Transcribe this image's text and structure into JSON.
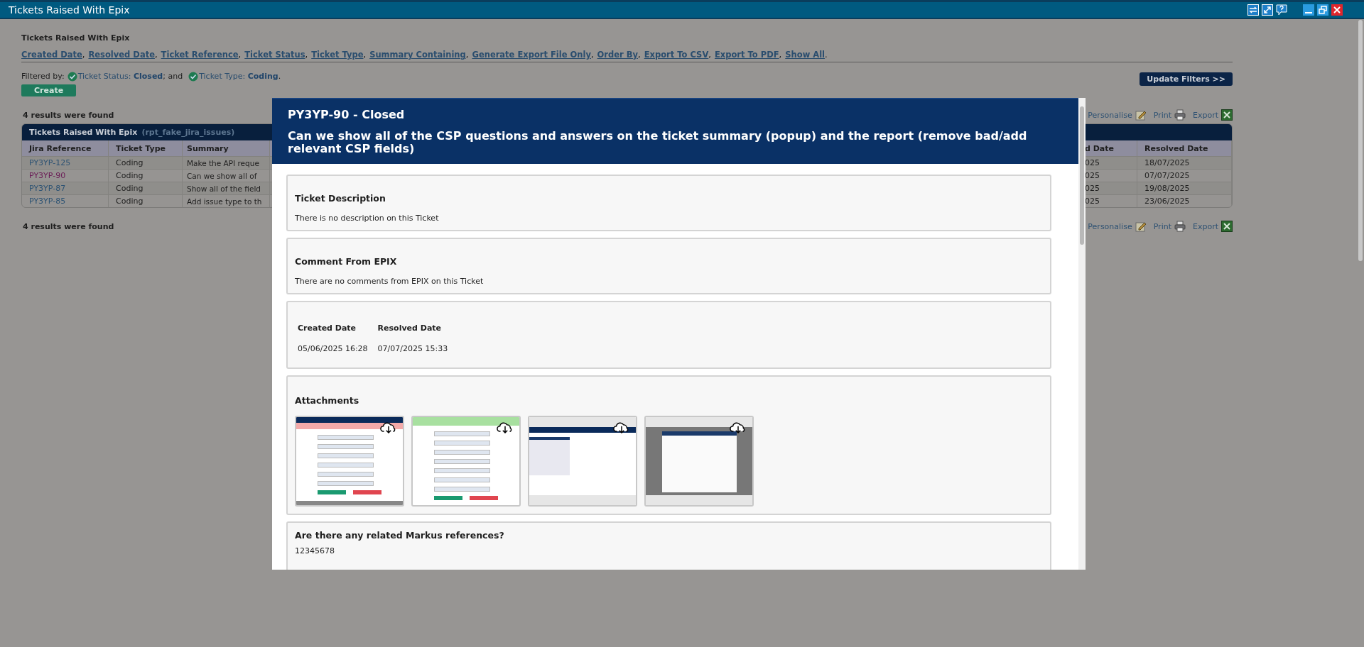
{
  "window": {
    "title": "Tickets Raised With Epix"
  },
  "page": {
    "heading": "Tickets Raised With Epix",
    "filter_links": [
      "Created Date",
      "Resolved Date",
      "Ticket Reference",
      "Ticket Status",
      "Ticket Type",
      "Summary Containing",
      "Generate Export File Only",
      "Order By",
      "Export To CSV",
      "Export To PDF",
      "Show All"
    ],
    "link_separator": ",",
    "links_end": ".",
    "filtered_by": {
      "label": "Filtered by:",
      "filters": [
        {
          "label": "Ticket Status:",
          "value": "Closed",
          "after": "; and"
        },
        {
          "label": "Ticket Type:",
          "value": "Coding",
          "after": "."
        }
      ]
    },
    "update_button": "Update Filters >>",
    "create_button": "Create",
    "results_top": "4 results were found",
    "results_bottom": "4 results were found",
    "toolbar_top": [
      "Personalise",
      "Print",
      "Export"
    ],
    "toolbar_bottom": [
      "Personalise",
      "Print",
      "Export"
    ]
  },
  "table": {
    "title": "Tickets Raised With Epix",
    "subtitle": "(rpt_fake_jira_issues)",
    "columns": [
      "Jira Reference",
      "Ticket Type",
      "Summary",
      "d Date",
      "Resolved Date"
    ],
    "rows": [
      {
        "visited": false,
        "cells": [
          "PY3YP-125",
          "Coding",
          "Make the API reque",
          "025",
          "18/07/2025"
        ]
      },
      {
        "visited": true,
        "cells": [
          "PY3YP-90",
          "Coding",
          "Can we show all of",
          "025",
          "07/07/2025"
        ]
      },
      {
        "visited": false,
        "cells": [
          "PY3YP-87",
          "Coding",
          "Show all of the field",
          "025",
          "19/08/2025"
        ]
      },
      {
        "visited": false,
        "cells": [
          "PY3YP-85",
          "Coding",
          "Add issue type to th",
          "025",
          "23/06/2025"
        ]
      }
    ]
  },
  "modal": {
    "ref_status": "PY3YP-90 - Closed",
    "title": "Can we show all of the CSP questions and answers on the ticket summary (popup) and the report (remove bad/add relevant CSP fields)",
    "sections": [
      {
        "kind": "text",
        "heading": "Ticket Description",
        "body": "There is no description on this Ticket"
      },
      {
        "kind": "text",
        "heading": "Comment From EPIX",
        "body": "There are no comments from EPIX on this Ticket"
      },
      {
        "kind": "dates",
        "fields": [
          {
            "label": "Created Date",
            "value": "05/06/2025 16:28"
          },
          {
            "label": "Resolved Date",
            "value": "07/07/2025 15:33"
          }
        ]
      },
      {
        "kind": "attachments",
        "heading": "Attachments",
        "items": [
          {
            "kind": "error_form"
          },
          {
            "kind": "success_form"
          },
          {
            "kind": "page"
          },
          {
            "kind": "dialog"
          }
        ]
      },
      {
        "kind": "question",
        "heading": "Are there any related Markus references?",
        "body": "12345678"
      }
    ]
  }
}
